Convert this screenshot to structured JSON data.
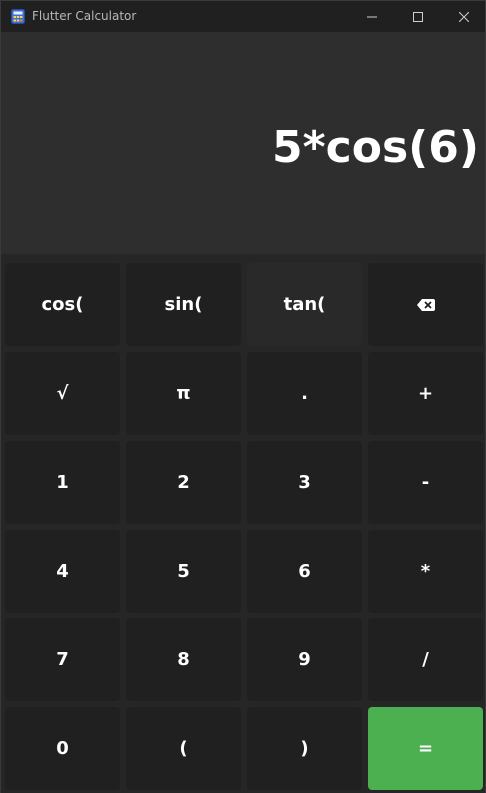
{
  "window": {
    "title": "Flutter Calculator"
  },
  "display": {
    "expression": "5*cos(6)"
  },
  "keypad": {
    "keys": [
      {
        "label": "cos("
      },
      {
        "label": "sin("
      },
      {
        "label": "tan("
      },
      {
        "label": ""
      },
      {
        "label": "√"
      },
      {
        "label": "π"
      },
      {
        "label": "."
      },
      {
        "label": "+"
      },
      {
        "label": "1"
      },
      {
        "label": "2"
      },
      {
        "label": "3"
      },
      {
        "label": "-"
      },
      {
        "label": "4"
      },
      {
        "label": "5"
      },
      {
        "label": "6"
      },
      {
        "label": "*"
      },
      {
        "label": "7"
      },
      {
        "label": "8"
      },
      {
        "label": "9"
      },
      {
        "label": "/"
      },
      {
        "label": "0"
      },
      {
        "label": "("
      },
      {
        "label": ")"
      },
      {
        "label": "="
      }
    ],
    "equals_color": "#4caf50"
  },
  "icons": {
    "app": "calculator-app-icon",
    "backspace": "backspace-icon",
    "minimize": "minimize-icon",
    "maximize": "maximize-icon",
    "close": "close-icon"
  }
}
